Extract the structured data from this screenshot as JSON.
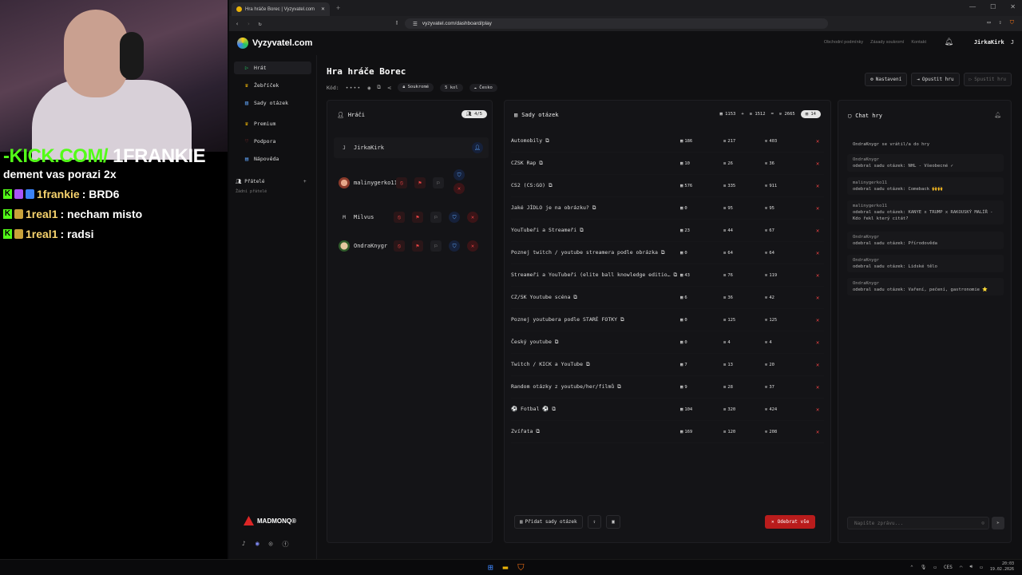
{
  "stream": {
    "banner_prefix": "-KICK.COM/",
    "banner_handle": " 1FRANKIE",
    "message_lines": [
      {
        "text": "dement vas porazi 2x"
      },
      {
        "user": "1frankie",
        "text": " : BRD6"
      },
      {
        "user": "1real1",
        "text": " : necham misto"
      },
      {
        "user": "1real1",
        "text": " : radsi"
      }
    ]
  },
  "browser": {
    "tab_title": "Hra hráče Borec | Vyzyvatel.com",
    "url": "vyzyvatel.com/dashboard/play"
  },
  "site": {
    "logo": "Vyzyvatel.com",
    "top_links": [
      "Obchodní podmínky",
      "Zásady soukromí",
      "Kontakt"
    ],
    "username": "JirkaKirk",
    "user_initial": "J"
  },
  "sidebar": {
    "items": [
      {
        "label": "Hrát",
        "icon": "▷"
      },
      {
        "label": "Žebříček",
        "icon": "♛"
      },
      {
        "label": "Sady otázek",
        "icon": "▥"
      },
      {
        "label": "Premium",
        "icon": "♛"
      },
      {
        "label": "Podpora",
        "icon": "♡"
      },
      {
        "label": "Nápověda",
        "icon": "▤"
      }
    ],
    "friends_label": "Přátelé",
    "friends_empty": "Žádní přátelé",
    "sponsor": "MADMONQ®"
  },
  "game": {
    "title": "Hra hráče Borec",
    "code_label": "Kód:",
    "code_value": "••••",
    "privacy": "Soukromé",
    "rounds": "5 kol",
    "region": "Česko",
    "buttons": {
      "settings": "Nastavení",
      "leave": "Opustit hru",
      "start": "Spustit hru"
    }
  },
  "players": {
    "title": "Hráči",
    "count": "4/5",
    "list": [
      {
        "name": "JirkaKirk",
        "initial": "J"
      },
      {
        "name": "malinygerko11",
        "initial": ""
      },
      {
        "name": "Milvus",
        "initial": "M"
      },
      {
        "name": "OndraKnygr",
        "initial": ""
      }
    ]
  },
  "question_sets": {
    "title": "Sady otázek",
    "totals": {
      "a": "1153",
      "b": "1512",
      "total": "2665",
      "count": "14"
    },
    "rows": [
      {
        "name": "Automobily",
        "a": "186",
        "b": "217",
        "c": "403"
      },
      {
        "name": "CZSK Rap",
        "a": "10",
        "b": "26",
        "c": "36"
      },
      {
        "name": "CS2 (CS:GO)",
        "a": "576",
        "b": "335",
        "c": "911"
      },
      {
        "name": "Jaké JÍDLO je na obrázku?",
        "a": "0",
        "b": "95",
        "c": "95"
      },
      {
        "name": "YouTubeři a Streameři",
        "a": "23",
        "b": "44",
        "c": "67"
      },
      {
        "name": "Poznej twitch / youtube streamera podle obrázka",
        "a": "0",
        "b": "64",
        "c": "64"
      },
      {
        "name": "Streameři a YouTubeři (elite ball knowledge editio…",
        "a": "43",
        "b": "76",
        "c": "119"
      },
      {
        "name": "CZ/SK Youtube scéna",
        "a": "6",
        "b": "36",
        "c": "42"
      },
      {
        "name": "Poznej youtubera podle STARÉ FOTKY",
        "a": "0",
        "b": "125",
        "c": "125"
      },
      {
        "name": "Český youtube",
        "a": "0",
        "b": "4",
        "c": "4"
      },
      {
        "name": "Twitch / KICK a YouTube",
        "a": "7",
        "b": "13",
        "c": "20"
      },
      {
        "name": "Random otázky z youtube/her/filmů",
        "a": "9",
        "b": "28",
        "c": "37"
      },
      {
        "name": "⚽ Fotbal ⚽",
        "a": "104",
        "b": "320",
        "c": "424"
      },
      {
        "name": "Zvířata",
        "a": "169",
        "b": "120",
        "c": "208"
      }
    ],
    "add_button": "Přidat sady otázek",
    "remove_all": "Odebrat vše"
  },
  "chat": {
    "title": "Chat hry",
    "messages": [
      {
        "user": "",
        "text": "OndraKnygr se vrátil/a do hry"
      },
      {
        "user": "OndraKnygr",
        "text": "odebral sadu otázek: NHL - Všeobecné ✓"
      },
      {
        "user": "malinygerko11",
        "text": "odebral sadu otázek: Comeback 🙌🙌"
      },
      {
        "user": "malinygerko11",
        "text": "odebral sadu otázek: KANYE x TRUMP x RAKOUSKÝ MALÍŘ - Kdo řekl který citát?"
      },
      {
        "user": "OndraKnygr",
        "text": "odebral sadu otázek: Přírodověda"
      },
      {
        "user": "OndraKnygr",
        "text": "odebral sadu otázek: Lidské tělo"
      },
      {
        "user": "OndraKnygr",
        "text": "odebral sadu otázek: Vaření, pečení, gastronomie ⭐"
      }
    ],
    "placeholder": "Napište zprávu..."
  },
  "taskbar": {
    "lang": "CES",
    "time": "20:03",
    "date": "19.02.2026"
  }
}
